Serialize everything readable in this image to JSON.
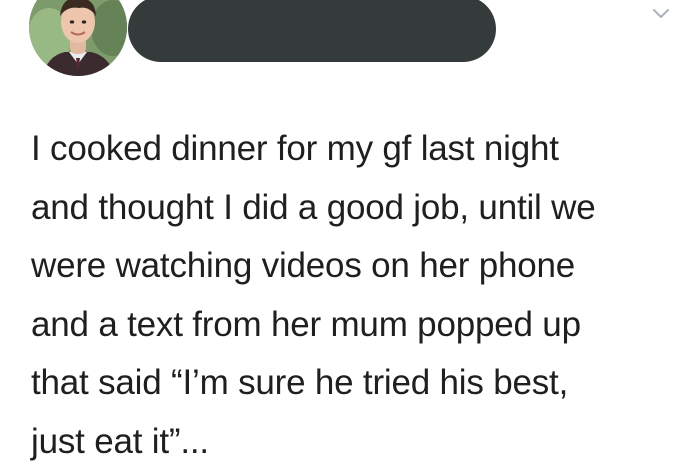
{
  "tweet": {
    "author_name_redacted": true,
    "text": "I cooked dinner for my gf last night\nand thought I did a good job, until we\nwere watching videos on her phone\nand a text from her mum popped up\nthat said “I’m sure he tried his best,\njust eat it”..."
  },
  "icons": {
    "menu": "chevron-down-icon"
  },
  "colors": {
    "redaction": "#353a3b",
    "text": "#1f1f1f",
    "caret": "#a9b4bd"
  }
}
